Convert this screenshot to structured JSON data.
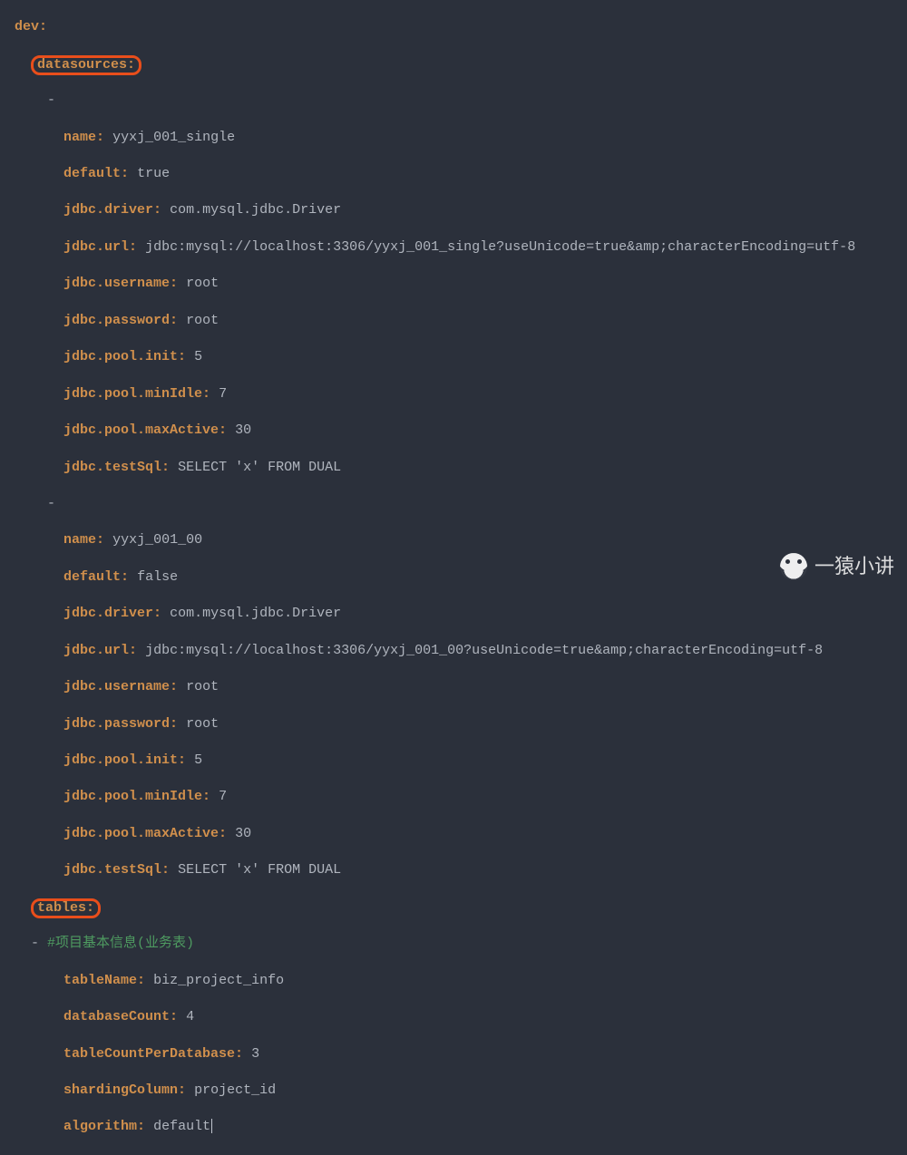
{
  "watermark": "一猿小讲",
  "code": {
    "dev": "dev",
    "datasources": "datasources",
    "tables": "tables",
    "comment1": "#项目基本信息(业务表)",
    "ds": [
      {
        "name_k": "name",
        "name_v": "yyxj_001_single",
        "default_k": "default",
        "default_v": "true",
        "driver_k": "jdbc.driver",
        "driver_v": "com.mysql.jdbc.Driver",
        "url_k": "jdbc.url",
        "url_v": "jdbc:mysql://localhost:3306/yyxj_001_single?useUnicode=true&amp;characterEncoding=utf-8",
        "user_k": "jdbc.username",
        "user_v": "root",
        "pass_k": "jdbc.password",
        "pass_v": "root",
        "init_k": "jdbc.pool.init",
        "init_v": "5",
        "minidle_k": "jdbc.pool.minIdle",
        "minidle_v": "7",
        "maxact_k": "jdbc.pool.maxActive",
        "maxact_v": "30",
        "testsql_k": "jdbc.testSql",
        "testsql_v": "SELECT 'x' FROM DUAL"
      },
      {
        "name_k": "name",
        "name_v": "yyxj_001_00",
        "default_k": "default",
        "default_v": "false",
        "driver_k": "jdbc.driver",
        "driver_v": "com.mysql.jdbc.Driver",
        "url_k": "jdbc.url",
        "url_v": "jdbc:mysql://localhost:3306/yyxj_001_00?useUnicode=true&amp;characterEncoding=utf-8",
        "user_k": "jdbc.username",
        "user_v": "root",
        "pass_k": "jdbc.password",
        "pass_v": "root",
        "init_k": "jdbc.pool.init",
        "init_v": "5",
        "minidle_k": "jdbc.pool.minIdle",
        "minidle_v": "7",
        "maxact_k": "jdbc.pool.maxActive",
        "maxact_v": "30",
        "testsql_k": "jdbc.testSql",
        "testsql_v": "SELECT 'x' FROM DUAL"
      }
    ],
    "table": {
      "tableName_k": "tableName",
      "tableName_v": "biz_project_info",
      "dbCount_k": "databaseCount",
      "dbCount_v": "4",
      "tcpd_k": "tableCountPerDatabase",
      "tcpd_v": "3",
      "shard_k": "shardingColumn",
      "shard_v": "project_id",
      "algo_k": "algorithm",
      "algo_v": "default"
    }
  }
}
